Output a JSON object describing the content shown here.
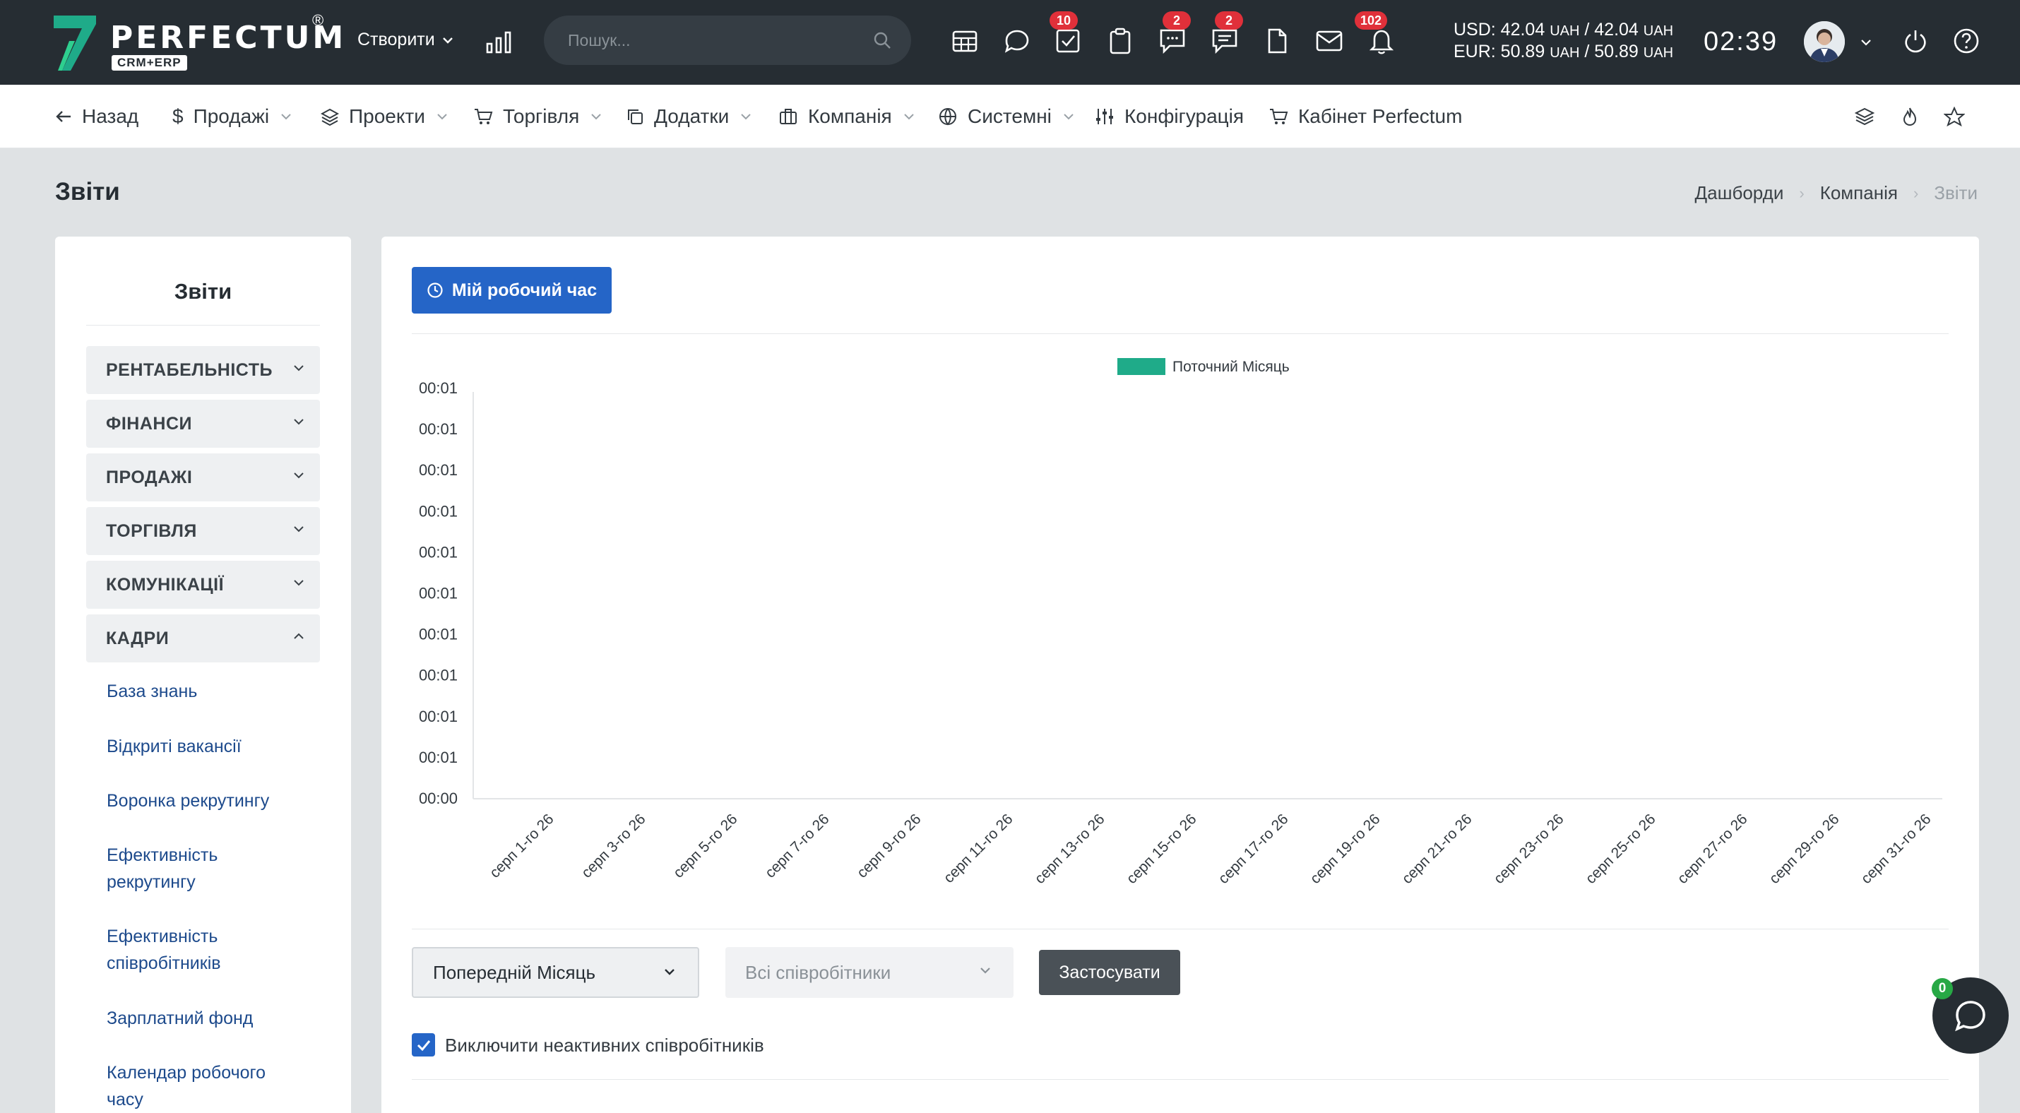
{
  "brand": {
    "name": "PERFECTUM",
    "registered": "®",
    "subtitle": "CRM+ERP"
  },
  "topbar": {
    "create_label": "Створити",
    "search_placeholder": "Пошук...",
    "badges": {
      "tasks": "10",
      "feedback": "2",
      "chat": "2",
      "notifications": "102"
    },
    "rates": {
      "usd": "USD: 42.04",
      "usd_mid": " / 42.04",
      "eur": "EUR: 50.89",
      "eur_mid": " / 50.89",
      "unit": "UAH"
    },
    "clock": "02:39"
  },
  "nav": {
    "back": "Назад",
    "sales": "Продажі",
    "projects": "Проекти",
    "trade": "Торгівля",
    "addons": "Додатки",
    "company": "Компанія",
    "system": "Системні",
    "config": "Конфігурація",
    "cabinet": "Кабінет Perfectum"
  },
  "page": {
    "title": "Звіти",
    "breadcrumb": [
      "Дашборди",
      "Компанія",
      "Звіти"
    ]
  },
  "sidebar": {
    "title": "Звіти",
    "sections": [
      "РЕНТАБЕЛЬНІСТЬ",
      "ФІНАНСИ",
      "ПРОДАЖІ",
      "ТОРГІВЛЯ",
      "КОМУНІКАЦІЇ",
      "КАДРИ"
    ],
    "links": [
      "База знань",
      "Відкриті вакансії",
      "Воронка рекрутингу",
      "Ефективність рекрутингу",
      "Ефективність співробітників",
      "Зарплатний фонд",
      "Календар робочого часу"
    ]
  },
  "main": {
    "my_time_button": "Мій робочий час",
    "period_select": "Попередній Місяць",
    "staff_select": "Всі співробітники",
    "apply_button": "Застосувати",
    "exclude_inactive_label": "Виключити неактивних співробітників",
    "exclude_inactive_checked": true
  },
  "chat_widget": {
    "count": "0"
  },
  "colors": {
    "accent": "#2565c7",
    "series": "#1fab89",
    "dark": "#262d33",
    "badge": "#e0303a"
  },
  "chart_data": {
    "type": "bar",
    "series": [
      {
        "name": "Поточний Місяць",
        "color": "#1fab89",
        "values": [
          0,
          0,
          0,
          0,
          0,
          0,
          0,
          0,
          0,
          0,
          0,
          0,
          0,
          0,
          0,
          0
        ]
      }
    ],
    "categories": [
      "серп 1-го 26",
      "серп 3-го 26",
      "серп 5-го 26",
      "серп 7-го 26",
      "серп 9-го 26",
      "серп 11-го 26",
      "серп 13-го 26",
      "серп 15-го 26",
      "серп 17-го 26",
      "серп 19-го 26",
      "серп 21-го 26",
      "серп 23-го 26",
      "серп 25-го 26",
      "серп 27-го 26",
      "серп 29-го 26",
      "серп 31-го 26"
    ],
    "y_tick_labels": [
      "00:00",
      "00:01",
      "00:01",
      "00:01",
      "00:01",
      "00:01",
      "00:01",
      "00:01",
      "00:01",
      "00:01",
      "00:01"
    ],
    "legend": "top-center",
    "grid": false
  }
}
